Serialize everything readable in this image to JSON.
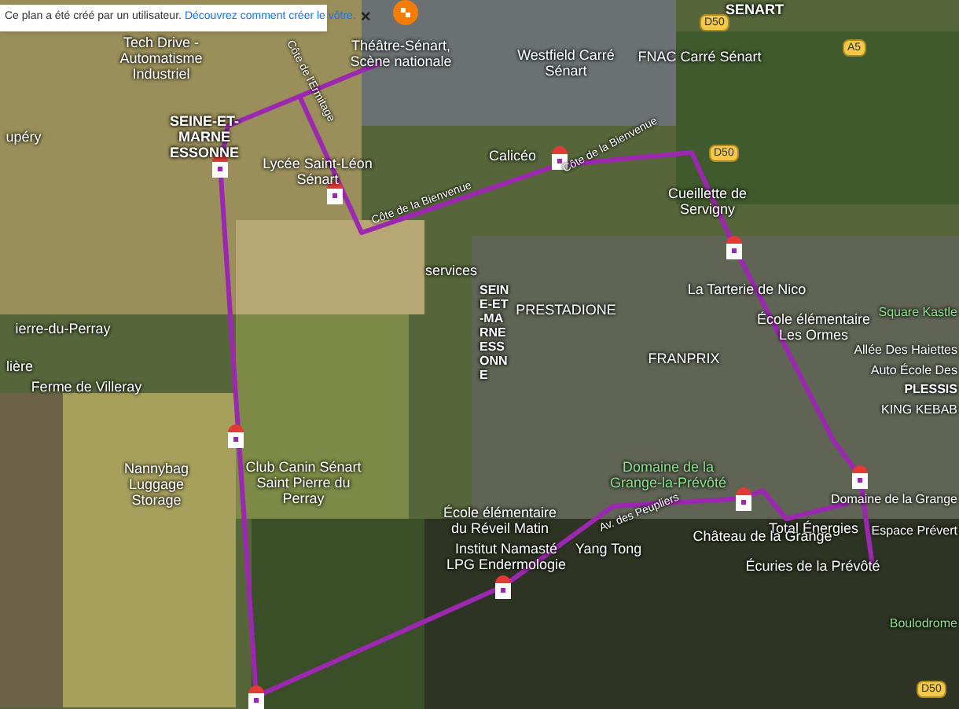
{
  "banner": {
    "text": "Ce plan a été créé par un utilisateur.",
    "link": "Découvrez comment créer le vôtre.",
    "close": "×"
  },
  "places": [
    {
      "kind": "area",
      "label": "SENART"
    },
    {
      "kind": "poi",
      "label": "Tech Drive - Automatisme Industriel"
    },
    {
      "kind": "area",
      "label": "SEINE-ET-MARNE ESSONNE"
    },
    {
      "kind": "poi",
      "label": "Lycée Saint-Léon Sénart"
    },
    {
      "kind": "poi",
      "label": "Théâtre-Sénart, Scène nationale"
    },
    {
      "kind": "poi",
      "label": "Westfield Carré Sénart"
    },
    {
      "kind": "poi",
      "label": "FNAC Carré Sénart"
    },
    {
      "kind": "poi",
      "label": "Calicéo"
    },
    {
      "kind": "poi",
      "label": "Cueillette de Servigny"
    },
    {
      "kind": "poi",
      "label": "services"
    },
    {
      "kind": "poi",
      "label": "PRESTADIONE"
    },
    {
      "kind": "poi",
      "label": "La Tarterie de Nico"
    },
    {
      "kind": "poi",
      "label": "École élémentaire Les Ormes"
    },
    {
      "kind": "park",
      "label": "Square Kastle"
    },
    {
      "kind": "poi",
      "label": "Allée Des Haiettes"
    },
    {
      "kind": "poi",
      "label": "Auto École Des"
    },
    {
      "kind": "area",
      "label": "PLESSIS"
    },
    {
      "kind": "poi",
      "label": "KING KEBAB"
    },
    {
      "kind": "poi",
      "label": "FRANPRIX"
    },
    {
      "kind": "poi",
      "label": "upéry"
    },
    {
      "kind": "poi",
      "label": "ierre-du-Perray"
    },
    {
      "kind": "poi",
      "label": "lière"
    },
    {
      "kind": "poi",
      "label": "Ferme de Villeray"
    },
    {
      "kind": "poi",
      "label": "Nannybag Luggage Storage"
    },
    {
      "kind": "poi",
      "label": "Club Canin Sénart Saint Pierre du Perray"
    },
    {
      "kind": "poi",
      "label": "École élémentaire du Réveil Matin"
    },
    {
      "kind": "poi",
      "label": "Institut Namasté LPG Endermologie"
    },
    {
      "kind": "poi",
      "label": "Yang Tong"
    },
    {
      "kind": "poi",
      "label": "Total Énergies"
    },
    {
      "kind": "poi",
      "label": "Espace Prévert"
    },
    {
      "kind": "park",
      "label": "Domaine de la Grange-la-Prévôté"
    },
    {
      "kind": "poi",
      "label": "Domaine de la Grange"
    },
    {
      "kind": "poi",
      "label": "Château de la Grange"
    },
    {
      "kind": "poi",
      "label": "Écuries de la Prévôté"
    },
    {
      "kind": "park",
      "label": "Boulodrome"
    },
    {
      "kind": "road",
      "label": "Côte de l'Ermitage"
    },
    {
      "kind": "road",
      "label": "Côte de la Bienvenue"
    },
    {
      "kind": "road",
      "label": "Côte de la Bienvenue"
    },
    {
      "kind": "road",
      "label": "Av. des Peupliers"
    },
    {
      "kind": "vertical",
      "label": "SEINE-ET-MARNE ESSONNE"
    },
    {
      "kind": "shield",
      "label": "D50"
    },
    {
      "kind": "shield",
      "label": "D50"
    },
    {
      "kind": "shield",
      "label": "A5"
    },
    {
      "kind": "shield",
      "label": "D50"
    }
  ]
}
